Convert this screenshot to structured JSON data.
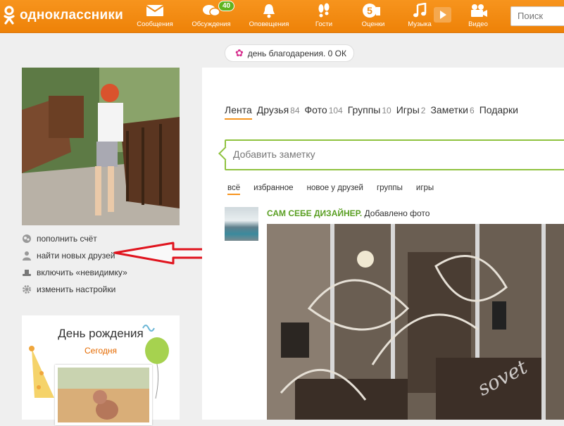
{
  "header": {
    "brand": "одноклассники",
    "nav": [
      {
        "label": "Сообщения",
        "icon": "envelope-icon"
      },
      {
        "label": "Обсуждения",
        "icon": "chat-bubbles-icon",
        "badge": "40"
      },
      {
        "label": "Оповещения",
        "icon": "bell-icon"
      },
      {
        "label": "Гости",
        "icon": "footprints-icon"
      },
      {
        "label": "Оценки",
        "icon": "rating-five-icon",
        "badge_glyph": "5"
      },
      {
        "label": "Музыка",
        "icon": "music-note-icon"
      },
      {
        "label": "Видео",
        "icon": "video-camera-icon"
      }
    ],
    "search_placeholder": "Поиск"
  },
  "left": {
    "menu": [
      {
        "label": "пополнить счёт",
        "icon": "coins-icon"
      },
      {
        "label": "найти новых друзей",
        "icon": "person-icon"
      },
      {
        "label": "включить «невидимку»",
        "icon": "hat-icon"
      },
      {
        "label": "изменить настройки",
        "icon": "gear-icon"
      }
    ],
    "birthday": {
      "title": "День рождения",
      "subtitle": "Сегодня"
    }
  },
  "main": {
    "holiday": "день благодарения. 0 ОК",
    "tabs": [
      {
        "label": "Лента",
        "count": ""
      },
      {
        "label": "Друзья",
        "count": "84"
      },
      {
        "label": "Фото",
        "count": "104"
      },
      {
        "label": "Группы",
        "count": "10"
      },
      {
        "label": "Игры",
        "count": "2"
      },
      {
        "label": "Заметки",
        "count": "6"
      },
      {
        "label": "Подарки",
        "count": ""
      }
    ],
    "note_placeholder": "Добавить заметку",
    "filters": [
      "всё",
      "избранное",
      "новое у друзей",
      "группы",
      "игры"
    ],
    "post": {
      "author": "САМ СЕБЕ ДИЗАЙНЕР.",
      "action": "Добавлено фото"
    },
    "watermark": "sovet"
  },
  "colors": {
    "brand_orange": "#f7941d",
    "accent_green": "#8fc23f",
    "annotation_red": "#e0141e"
  }
}
